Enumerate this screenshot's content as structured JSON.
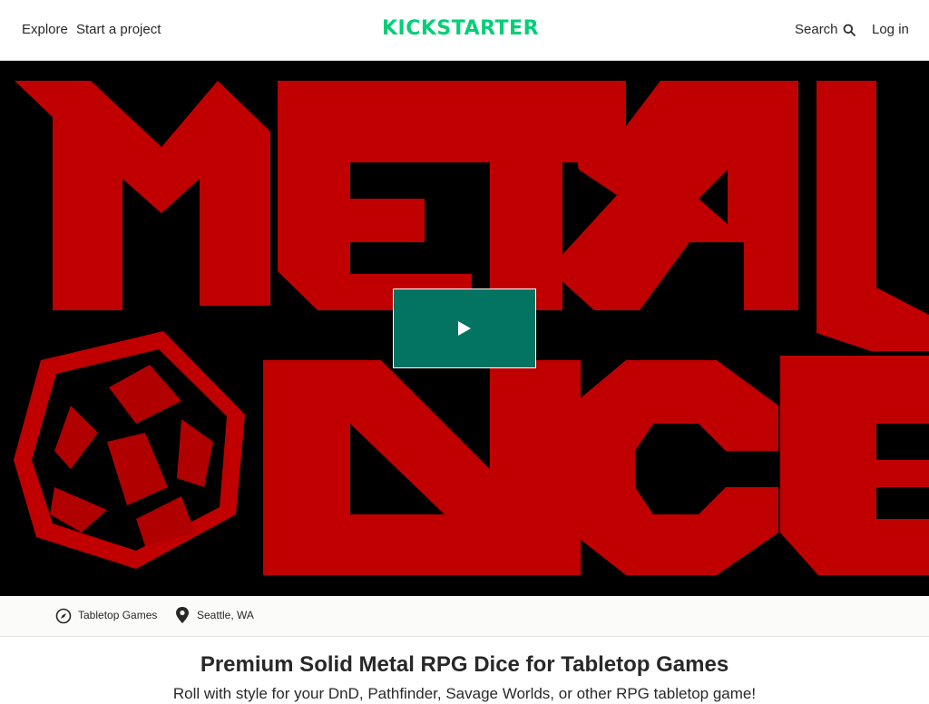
{
  "nav": {
    "explore": "Explore",
    "start_project": "Start a project",
    "logo": "KICKSTARTER",
    "search": "Search",
    "login": "Log in"
  },
  "hero": {
    "play_icon": "play-icon",
    "artwork_text": "METAL DICE"
  },
  "meta": {
    "category": "Tabletop Games",
    "location": "Seattle, WA"
  },
  "project": {
    "title": "Premium Solid Metal RPG Dice for Tabletop Games",
    "blurb": "Roll with style for your DnD, Pathfinder, Savage Worlds, or other RPG tabletop game!"
  },
  "colors": {
    "brand": "#05ce78",
    "play_button": "#037362",
    "hero_red": "#c00000"
  }
}
